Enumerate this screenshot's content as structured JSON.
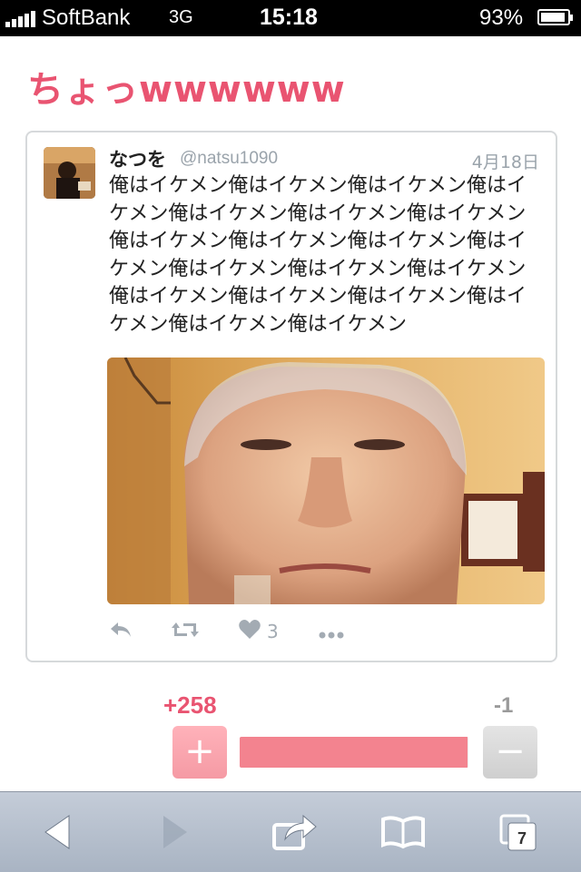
{
  "status_bar": {
    "carrier": "SoftBank",
    "network": "3G",
    "time": "15:18",
    "battery": "93%",
    "battery_level": 0.93
  },
  "page": {
    "title": "ちょっwwwwww"
  },
  "tweet": {
    "name": "なつを",
    "handle": "@natsu1090",
    "date": "4月18日",
    "text": "俺はイケメン俺はイケメン俺はイケメン俺はイケメン俺はイケメン俺はイケメン俺はイケメン俺はイケメン俺はイケメン俺はイケメン俺はイケメン俺はイケメン俺はイケメン俺はイケメン俺はイケメン俺はイケメン俺はイケメン俺はイケメン俺はイケメン俺はイケメン",
    "likes": "3",
    "icons": [
      "reply-icon",
      "retweet-icon",
      "heart-icon",
      "more-icon"
    ]
  },
  "votes": {
    "plus_count": "+258",
    "minus_count": "-1",
    "plus_label": "+",
    "minus_label": "−",
    "plus_ratio": 0.996,
    "plus_color": "#e95471",
    "bar_color": "#f3838f"
  },
  "toolbar": {
    "tabs_count": "7",
    "icons": [
      "back-icon",
      "forward-icon",
      "share-icon",
      "bookmarks-icon",
      "tabs-icon"
    ]
  }
}
